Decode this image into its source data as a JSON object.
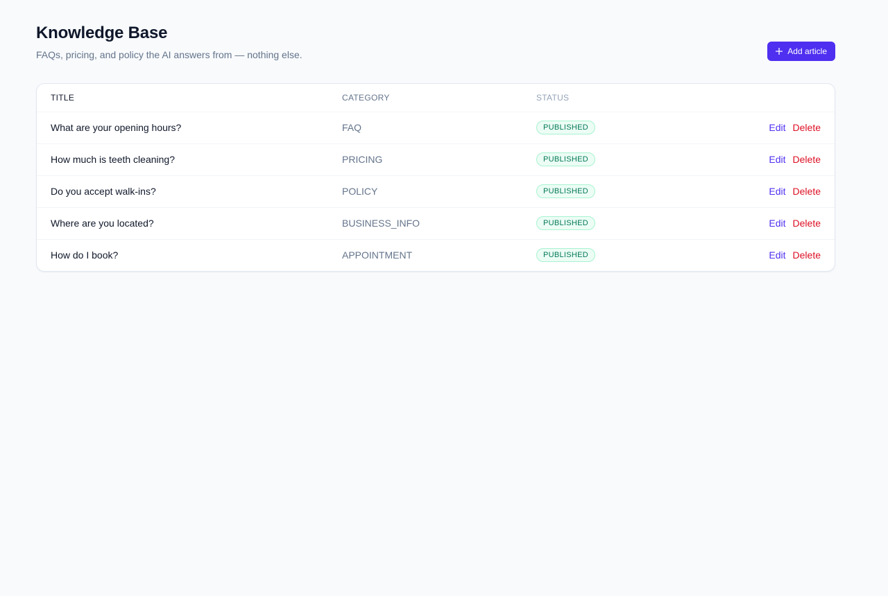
{
  "header": {
    "title": "Knowledge Base",
    "subtitle": "FAQs, pricing, and policy the AI answers from — nothing else.",
    "add_button_label": "Add article",
    "add_button_icon": "plus-icon"
  },
  "table": {
    "columns": [
      "TITLE",
      "CATEGORY",
      "STATUS"
    ],
    "action_labels": {
      "edit": "Edit",
      "delete": "Delete"
    },
    "rows": [
      {
        "title": "What are your opening hours?",
        "category": "FAQ",
        "status": "PUBLISHED"
      },
      {
        "title": "How much is teeth cleaning?",
        "category": "PRICING",
        "status": "PUBLISHED"
      },
      {
        "title": "Do you accept walk-ins?",
        "category": "POLICY",
        "status": "PUBLISHED"
      },
      {
        "title": "Where are you located?",
        "category": "BUSINESS_INFO",
        "status": "PUBLISHED"
      },
      {
        "title": "How do I book?",
        "category": "APPOINTMENT",
        "status": "PUBLISHED"
      }
    ]
  },
  "colors": {
    "accent": "#4f2ff0",
    "danger": "#dc0f23",
    "success_text": "#047857",
    "success_bg": "#ecfdf5",
    "background": "#f8fafc"
  }
}
